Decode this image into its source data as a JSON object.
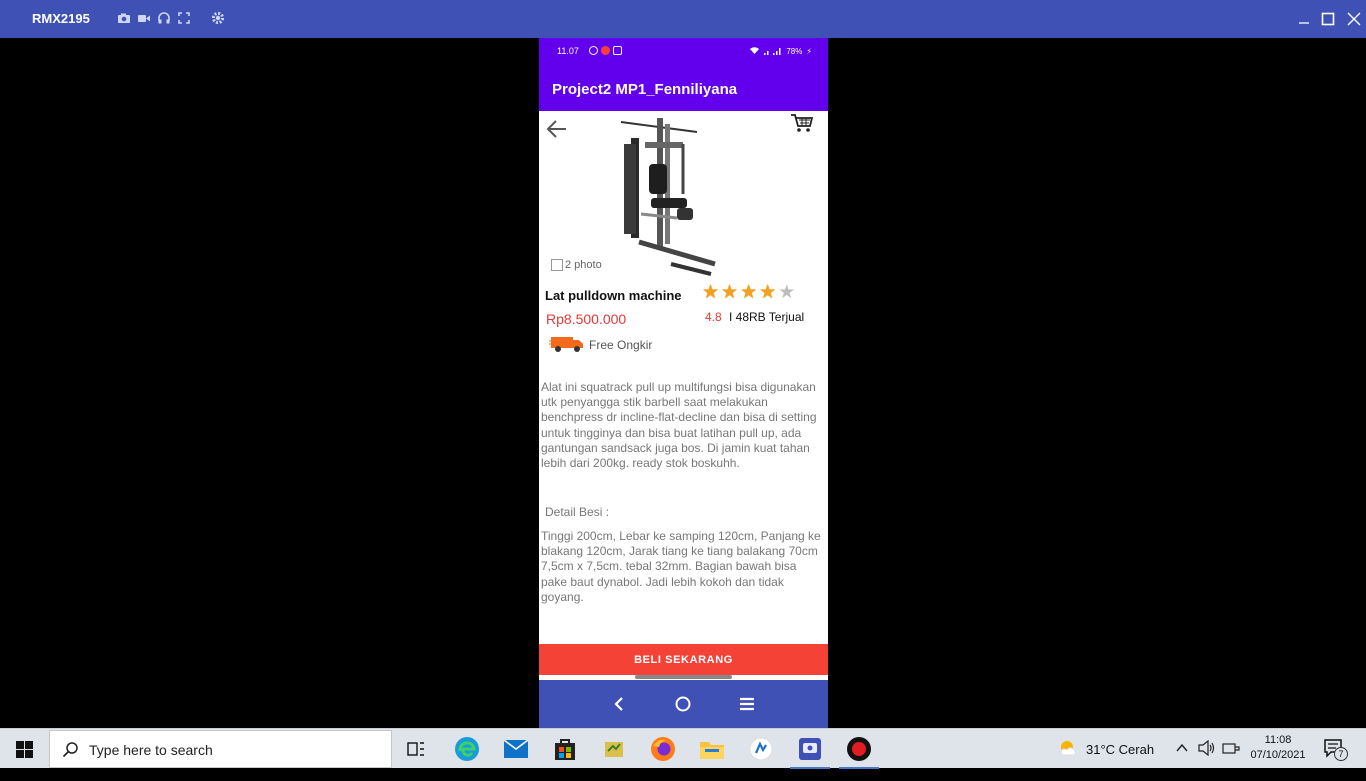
{
  "window": {
    "device_name": "RMX2195",
    "accent": "#3f51b5"
  },
  "phone": {
    "status": {
      "time": "11.07",
      "battery": "78%"
    },
    "app_title": "Project2 MP1_Fenniliyana",
    "product": {
      "photo_count": "2 photo",
      "name": "Lat pulldown machine",
      "price": "Rp8.500.000",
      "rating": "4.8",
      "rating_stars": 4,
      "sold": "I 48RB Terjual",
      "shipping": "Free Ongkir",
      "description": "Alat ini squatrack pull up multifungsi bisa digunakan utk penyangga stik barbell saat melakukan benchpress dr incline-flat-decline dan bisa di setting untuk tingginya dan bisa buat latihan pull up, ada gantungan sandsack juga bos. Di jamin kuat tahan lebih dari 200kg. ready stok boskuhh.",
      "detail_title": "Detail Besi :",
      "detail": "Tinggi 200cm, Lebar ke samping 120cm, Panjang ke blakang 120cm, Jarak tiang ke tiang balakang 70cm 7,5cm x 7,5cm. tebal 32mm. Bagian bawah bisa pake baut dynabol. Jadi lebih kokoh dan tidak goyang."
    },
    "buy_button": "BELI SEKARANG",
    "colors": {
      "app_bar": "#6200ee",
      "price": "#e53935",
      "buy": "#f44336",
      "nav": "#3f51b5"
    }
  },
  "taskbar": {
    "search_placeholder": "Type here to search",
    "weather": "31°C  Cerah",
    "time": "11:08",
    "date": "07/10/2021",
    "notification_count": "7"
  }
}
